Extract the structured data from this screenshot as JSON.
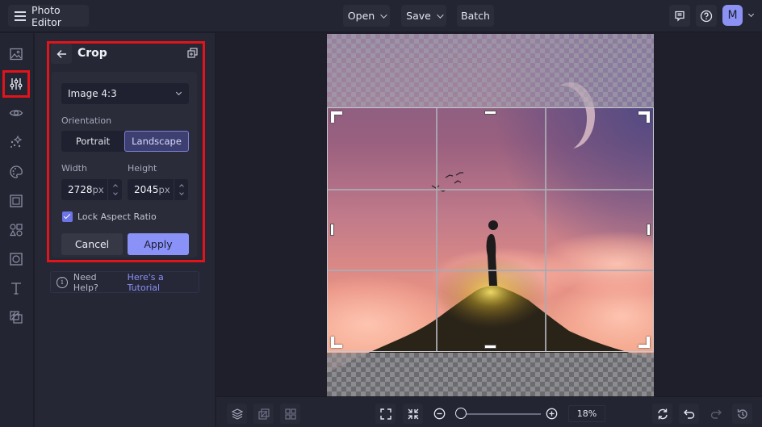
{
  "topbar": {
    "app_title": "Photo Editor",
    "open_label": "Open",
    "save_label": "Save",
    "batch_label": "Batch",
    "avatar_initial": "M",
    "icons": [
      "menu-icon",
      "feedback-icon",
      "help-icon",
      "chevron-down-icon"
    ]
  },
  "rail": {
    "items": [
      {
        "name": "image",
        "icon": "image-icon",
        "active": false
      },
      {
        "name": "adjust",
        "icon": "sliders-icon",
        "active": true
      },
      {
        "name": "view",
        "icon": "eye-icon",
        "active": false
      },
      {
        "name": "effects",
        "icon": "sparkles-icon",
        "active": false
      },
      {
        "name": "artsy",
        "icon": "palette-icon",
        "active": false
      },
      {
        "name": "frames",
        "icon": "frame-icon",
        "active": false
      },
      {
        "name": "graphics",
        "icon": "shapes-icon",
        "active": false
      },
      {
        "name": "overlays",
        "icon": "overlay-icon",
        "active": false
      },
      {
        "name": "text",
        "icon": "text-icon",
        "active": false
      },
      {
        "name": "layers",
        "icon": "layers-icon",
        "active": false
      }
    ]
  },
  "panel": {
    "title": "Crop",
    "preset": "Image 4:3",
    "orientation_label": "Orientation",
    "orientation_options": [
      "Portrait",
      "Landscape"
    ],
    "orientation_selected": "Landscape",
    "width_label": "Width",
    "height_label": "Height",
    "width_value": "2728",
    "height_value": "2045",
    "unit": "px",
    "lock_label": "Lock Aspect Ratio",
    "lock_checked": true,
    "cancel_label": "Cancel",
    "apply_label": "Apply",
    "help_text": "Need Help?",
    "help_link": "Here's a Tutorial"
  },
  "bottombar": {
    "zoom_value": "18%",
    "zoom_fraction": 0.05,
    "icons": [
      "layers-icon",
      "duplicate-icon",
      "grid-icon",
      "fit-screen-icon",
      "actual-size-icon",
      "zoom-out-icon",
      "zoom-in-icon",
      "reset-icon",
      "undo-icon",
      "redo-icon",
      "history-icon"
    ]
  },
  "colors": {
    "accent": "#8a91f7",
    "highlight": "#e1141b",
    "background": "#232532"
  }
}
